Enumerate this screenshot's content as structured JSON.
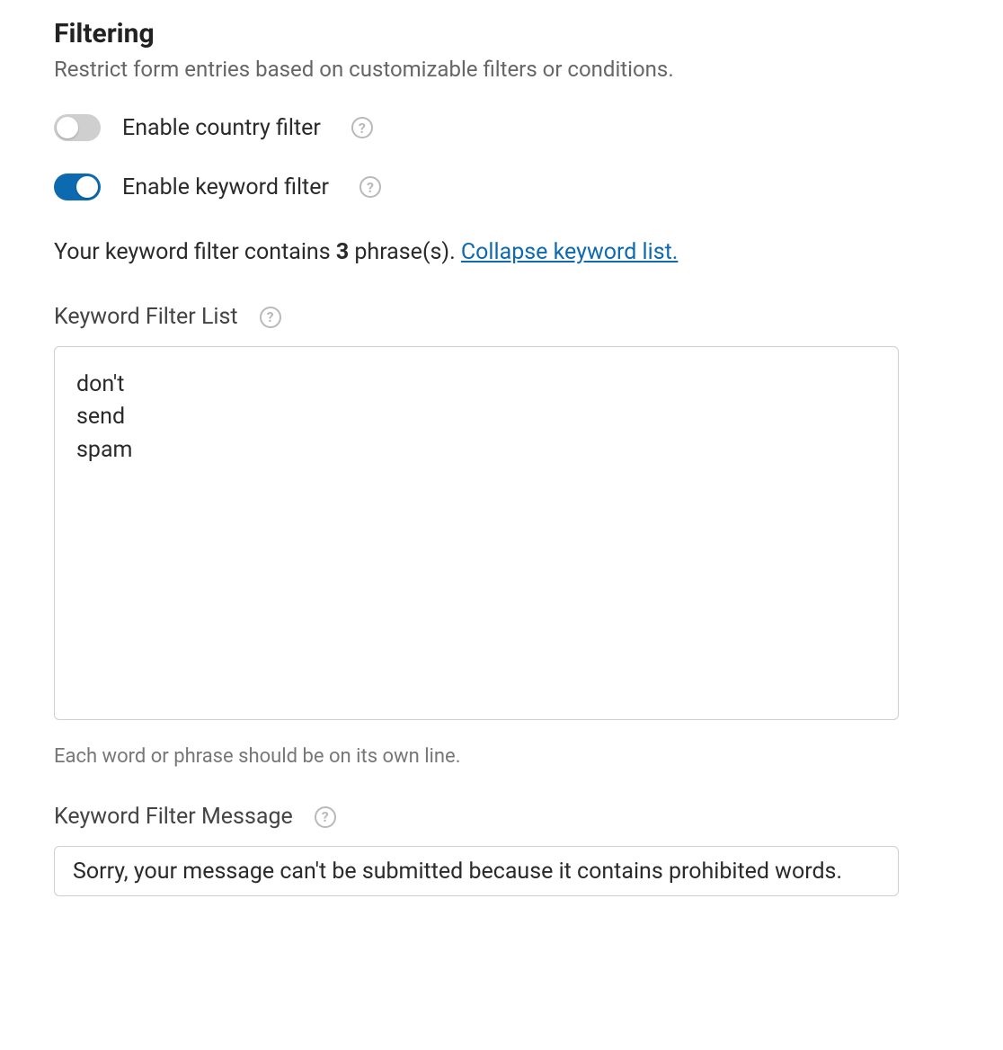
{
  "filtering": {
    "title": "Filtering",
    "subtitle": "Restrict form entries based on customizable filters or conditions.",
    "country_filter": {
      "enabled": false,
      "label": "Enable country filter"
    },
    "keyword_filter": {
      "enabled": true,
      "label": "Enable keyword filter",
      "summary_prefix": "Your keyword filter contains ",
      "count": "3",
      "summary_suffix": " phrase(s). ",
      "collapse_link": "Collapse keyword list.",
      "list_label": "Keyword Filter List",
      "list_value": "don't\nsend\nspam",
      "list_hint": "Each word or phrase should be on its own line.",
      "message_label": "Keyword Filter Message",
      "message_value": "Sorry, your message can't be submitted because it contains prohibited words."
    }
  }
}
